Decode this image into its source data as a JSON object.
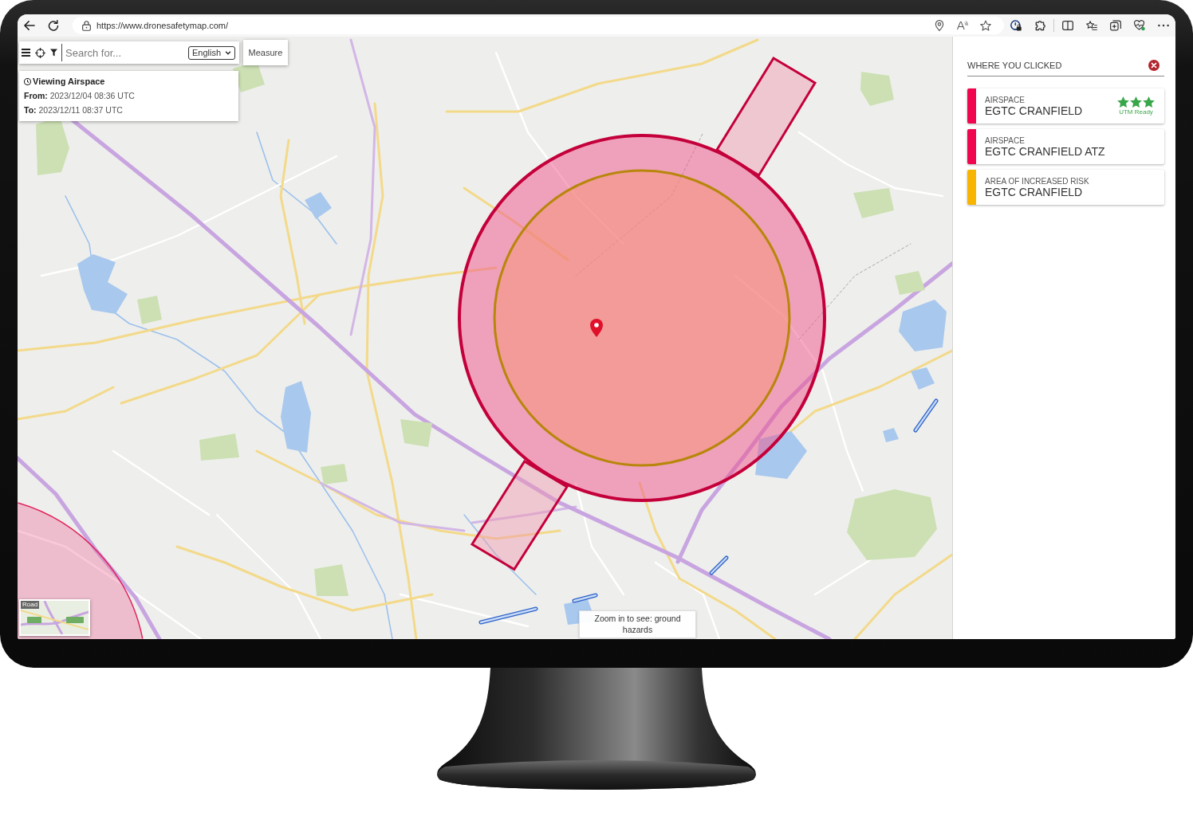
{
  "browser": {
    "url": "https://www.dronesafetymap.com/"
  },
  "map_toolbar": {
    "search": {
      "placeholder": "Search for..."
    },
    "language": "English",
    "measure_button": "Measure"
  },
  "viewing_card": {
    "title": "Viewing Airspace",
    "from": "**From:** 2023/12/04 08:36 UTC",
    "to": "**To:** 2023/12/11 08:37 UTC"
  },
  "layer_switcher": {
    "label": "Road"
  },
  "map_notice": "Zoom in to see: ground hazards",
  "panel": {
    "title": "WHERE YOU CLICKED",
    "results": [
      {
        "category": "AIRSPACE",
        "name": "EGTC CRANFIELD",
        "color": "#f0064f",
        "stars": 3,
        "badge": "UTM Ready"
      },
      {
        "category": "AIRSPACE",
        "name": "EGTC CRANFIELD ATZ",
        "color": "#f0064f"
      },
      {
        "category": "AREA OF INCREASED RISK",
        "name": "EGTC CRANFIELD",
        "color": "#f8b500"
      }
    ]
  }
}
